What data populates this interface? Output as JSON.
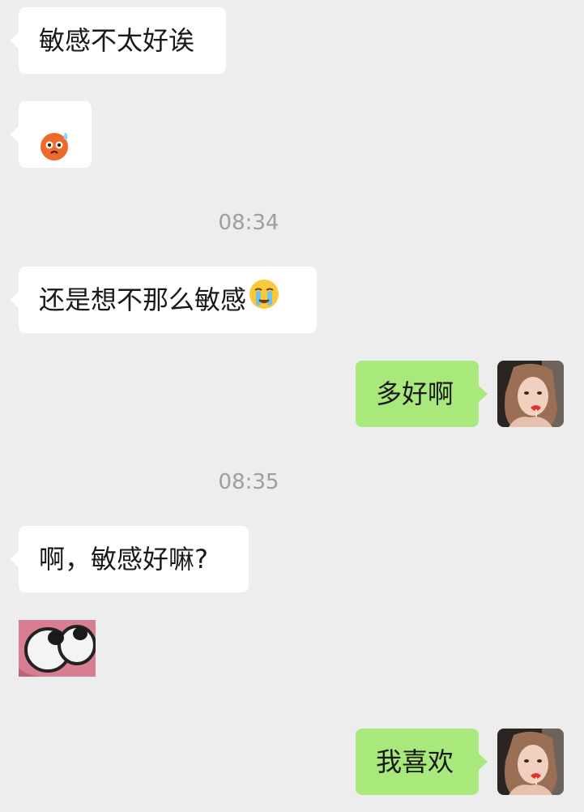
{
  "chat": {
    "messages": [
      {
        "id": "m1",
        "side": "in",
        "type": "text",
        "text": "敏感不太好诶"
      },
      {
        "id": "m2",
        "side": "in",
        "type": "emoji",
        "emoji": "anxious-sweat-face-icon"
      },
      {
        "id": "t1",
        "type": "timestamp",
        "text": "08:34"
      },
      {
        "id": "m3",
        "side": "in",
        "type": "text",
        "text": "还是想不那么敏感",
        "emoji": "crying-face-icon"
      },
      {
        "id": "m4",
        "side": "out",
        "type": "text",
        "text": "多好啊"
      },
      {
        "id": "t2",
        "type": "timestamp",
        "text": "08:35"
      },
      {
        "id": "m5",
        "side": "in",
        "type": "text",
        "text": "啊，敏感好嘛?"
      },
      {
        "id": "m6",
        "side": "in",
        "type": "sticker",
        "sticker": "rolling-eyes-sticker"
      },
      {
        "id": "m7",
        "side": "out",
        "type": "text",
        "text": "我喜欢"
      }
    ]
  },
  "colors": {
    "background": "#ededed",
    "incoming_bubble": "#ffffff",
    "outgoing_bubble": "#a9e97b",
    "timestamp_text": "#9e9e9e",
    "message_text": "#191919"
  }
}
